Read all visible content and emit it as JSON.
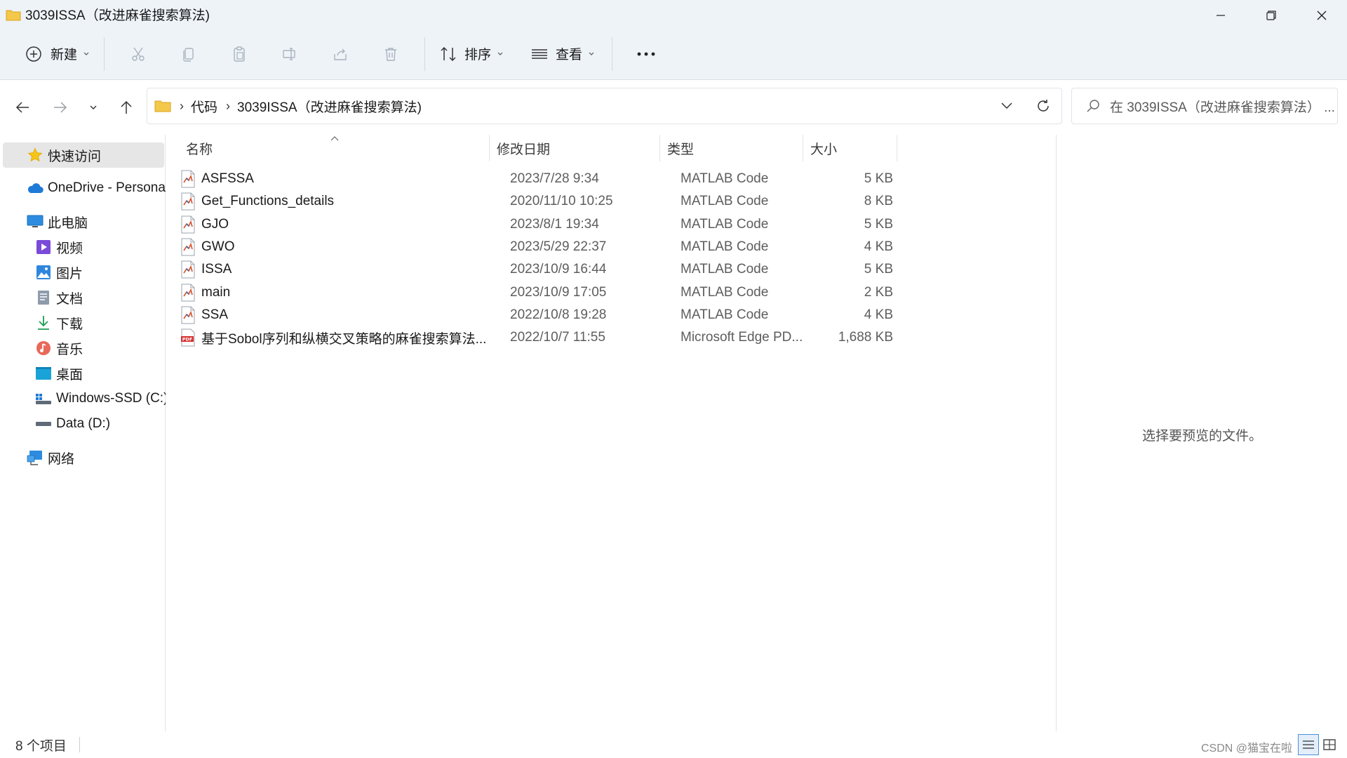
{
  "window": {
    "title": "3039ISSA（改进麻雀搜索算法)"
  },
  "toolbar": {
    "new_label": "新建",
    "sort_label": "排序",
    "view_label": "查看",
    "more_label": "..."
  },
  "address": {
    "segments": [
      "代码",
      "3039ISSA（改进麻雀搜索算法)"
    ]
  },
  "search": {
    "placeholder": "在 3039ISSA（改进麻雀搜索算法） ..."
  },
  "sidebar": {
    "items": [
      {
        "label": "快速访问",
        "icon": "star-icon"
      },
      {
        "label": "OneDrive - Personal",
        "icon": "cloud-icon"
      },
      {
        "label": "此电脑",
        "icon": "computer-icon"
      },
      {
        "label": "视频",
        "icon": "video-icon"
      },
      {
        "label": "图片",
        "icon": "picture-icon"
      },
      {
        "label": "文档",
        "icon": "document-icon"
      },
      {
        "label": "下载",
        "icon": "download-icon"
      },
      {
        "label": "音乐",
        "icon": "music-icon"
      },
      {
        "label": "桌面",
        "icon": "desktop-icon"
      },
      {
        "label": "Windows-SSD (C:)",
        "icon": "drive-c-icon"
      },
      {
        "label": "Data (D:)",
        "icon": "drive-d-icon"
      },
      {
        "label": "网络",
        "icon": "network-icon"
      }
    ]
  },
  "columns": {
    "name": "名称",
    "date": "修改日期",
    "type": "类型",
    "size": "大小"
  },
  "files": [
    {
      "name": "ASFSSA",
      "date": "2023/7/28 9:34",
      "type": "MATLAB Code",
      "size": "5 KB",
      "icon": "matlab-file-icon"
    },
    {
      "name": "Get_Functions_details",
      "date": "2020/11/10 10:25",
      "type": "MATLAB Code",
      "size": "8 KB",
      "icon": "matlab-file-icon"
    },
    {
      "name": "GJO",
      "date": "2023/8/1 19:34",
      "type": "MATLAB Code",
      "size": "5 KB",
      "icon": "matlab-file-icon"
    },
    {
      "name": "GWO",
      "date": "2023/5/29 22:37",
      "type": "MATLAB Code",
      "size": "4 KB",
      "icon": "matlab-file-icon"
    },
    {
      "name": "ISSA",
      "date": "2023/10/9 16:44",
      "type": "MATLAB Code",
      "size": "5 KB",
      "icon": "matlab-file-icon"
    },
    {
      "name": "main",
      "date": "2023/10/9 17:05",
      "type": "MATLAB Code",
      "size": "2 KB",
      "icon": "matlab-file-icon"
    },
    {
      "name": "SSA",
      "date": "2022/10/8 19:28",
      "type": "MATLAB Code",
      "size": "4 KB",
      "icon": "matlab-file-icon"
    },
    {
      "name": "基于Sobol序列和纵横交叉策略的麻雀搜索算法...",
      "date": "2022/10/7 11:55",
      "type": "Microsoft Edge PD...",
      "size": "1,688 KB",
      "icon": "pdf-file-icon"
    }
  ],
  "preview": {
    "message": "选择要预览的文件。"
  },
  "status": {
    "count": "8 个项目",
    "watermark": "CSDN @猫宝在啦"
  },
  "colors": {
    "chrome_bg": "#eef3f8",
    "folder_yellow": "#f4c84a",
    "selection_gray": "#e6e6e6",
    "accent_blue": "#4a90d9"
  }
}
